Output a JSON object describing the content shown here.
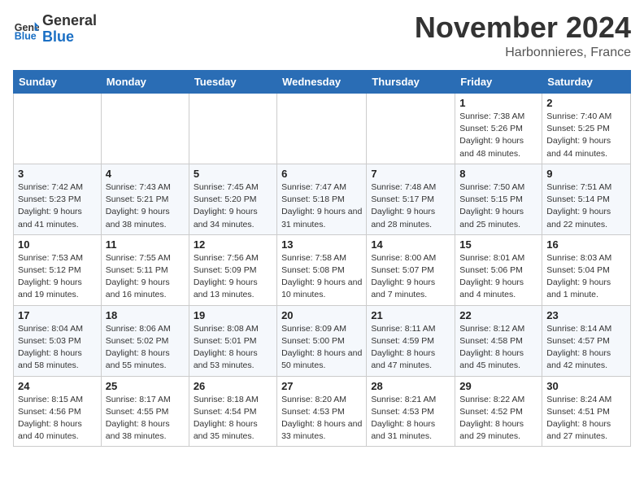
{
  "header": {
    "logo_line1": "General",
    "logo_line2": "Blue",
    "month": "November 2024",
    "location": "Harbonnieres, France"
  },
  "weekdays": [
    "Sunday",
    "Monday",
    "Tuesday",
    "Wednesday",
    "Thursday",
    "Friday",
    "Saturday"
  ],
  "rows": [
    [
      {
        "day": "",
        "info": ""
      },
      {
        "day": "",
        "info": ""
      },
      {
        "day": "",
        "info": ""
      },
      {
        "day": "",
        "info": ""
      },
      {
        "day": "",
        "info": ""
      },
      {
        "day": "1",
        "info": "Sunrise: 7:38 AM\nSunset: 5:26 PM\nDaylight: 9 hours and 48 minutes."
      },
      {
        "day": "2",
        "info": "Sunrise: 7:40 AM\nSunset: 5:25 PM\nDaylight: 9 hours and 44 minutes."
      }
    ],
    [
      {
        "day": "3",
        "info": "Sunrise: 7:42 AM\nSunset: 5:23 PM\nDaylight: 9 hours and 41 minutes."
      },
      {
        "day": "4",
        "info": "Sunrise: 7:43 AM\nSunset: 5:21 PM\nDaylight: 9 hours and 38 minutes."
      },
      {
        "day": "5",
        "info": "Sunrise: 7:45 AM\nSunset: 5:20 PM\nDaylight: 9 hours and 34 minutes."
      },
      {
        "day": "6",
        "info": "Sunrise: 7:47 AM\nSunset: 5:18 PM\nDaylight: 9 hours and 31 minutes."
      },
      {
        "day": "7",
        "info": "Sunrise: 7:48 AM\nSunset: 5:17 PM\nDaylight: 9 hours and 28 minutes."
      },
      {
        "day": "8",
        "info": "Sunrise: 7:50 AM\nSunset: 5:15 PM\nDaylight: 9 hours and 25 minutes."
      },
      {
        "day": "9",
        "info": "Sunrise: 7:51 AM\nSunset: 5:14 PM\nDaylight: 9 hours and 22 minutes."
      }
    ],
    [
      {
        "day": "10",
        "info": "Sunrise: 7:53 AM\nSunset: 5:12 PM\nDaylight: 9 hours and 19 minutes."
      },
      {
        "day": "11",
        "info": "Sunrise: 7:55 AM\nSunset: 5:11 PM\nDaylight: 9 hours and 16 minutes."
      },
      {
        "day": "12",
        "info": "Sunrise: 7:56 AM\nSunset: 5:09 PM\nDaylight: 9 hours and 13 minutes."
      },
      {
        "day": "13",
        "info": "Sunrise: 7:58 AM\nSunset: 5:08 PM\nDaylight: 9 hours and 10 minutes."
      },
      {
        "day": "14",
        "info": "Sunrise: 8:00 AM\nSunset: 5:07 PM\nDaylight: 9 hours and 7 minutes."
      },
      {
        "day": "15",
        "info": "Sunrise: 8:01 AM\nSunset: 5:06 PM\nDaylight: 9 hours and 4 minutes."
      },
      {
        "day": "16",
        "info": "Sunrise: 8:03 AM\nSunset: 5:04 PM\nDaylight: 9 hours and 1 minute."
      }
    ],
    [
      {
        "day": "17",
        "info": "Sunrise: 8:04 AM\nSunset: 5:03 PM\nDaylight: 8 hours and 58 minutes."
      },
      {
        "day": "18",
        "info": "Sunrise: 8:06 AM\nSunset: 5:02 PM\nDaylight: 8 hours and 55 minutes."
      },
      {
        "day": "19",
        "info": "Sunrise: 8:08 AM\nSunset: 5:01 PM\nDaylight: 8 hours and 53 minutes."
      },
      {
        "day": "20",
        "info": "Sunrise: 8:09 AM\nSunset: 5:00 PM\nDaylight: 8 hours and 50 minutes."
      },
      {
        "day": "21",
        "info": "Sunrise: 8:11 AM\nSunset: 4:59 PM\nDaylight: 8 hours and 47 minutes."
      },
      {
        "day": "22",
        "info": "Sunrise: 8:12 AM\nSunset: 4:58 PM\nDaylight: 8 hours and 45 minutes."
      },
      {
        "day": "23",
        "info": "Sunrise: 8:14 AM\nSunset: 4:57 PM\nDaylight: 8 hours and 42 minutes."
      }
    ],
    [
      {
        "day": "24",
        "info": "Sunrise: 8:15 AM\nSunset: 4:56 PM\nDaylight: 8 hours and 40 minutes."
      },
      {
        "day": "25",
        "info": "Sunrise: 8:17 AM\nSunset: 4:55 PM\nDaylight: 8 hours and 38 minutes."
      },
      {
        "day": "26",
        "info": "Sunrise: 8:18 AM\nSunset: 4:54 PM\nDaylight: 8 hours and 35 minutes."
      },
      {
        "day": "27",
        "info": "Sunrise: 8:20 AM\nSunset: 4:53 PM\nDaylight: 8 hours and 33 minutes."
      },
      {
        "day": "28",
        "info": "Sunrise: 8:21 AM\nSunset: 4:53 PM\nDaylight: 8 hours and 31 minutes."
      },
      {
        "day": "29",
        "info": "Sunrise: 8:22 AM\nSunset: 4:52 PM\nDaylight: 8 hours and 29 minutes."
      },
      {
        "day": "30",
        "info": "Sunrise: 8:24 AM\nSunset: 4:51 PM\nDaylight: 8 hours and 27 minutes."
      }
    ]
  ]
}
